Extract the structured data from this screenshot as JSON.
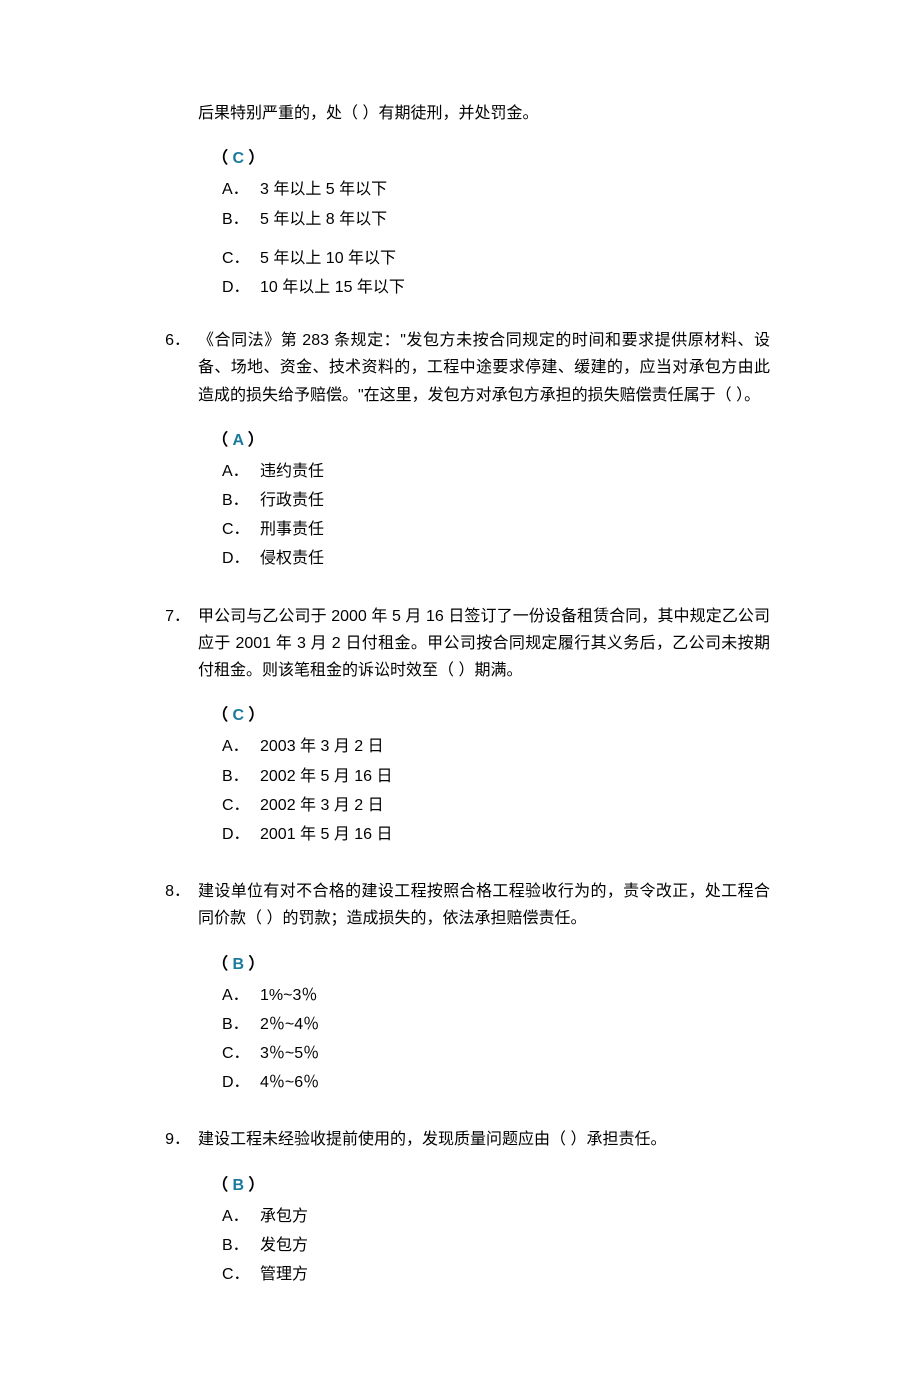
{
  "continuation": {
    "text": "后果特别严重的，处（ ）有期徒刑，并处罚金。",
    "answer": "C",
    "options": [
      {
        "letter": "A．",
        "text": "3 年以上 5 年以下"
      },
      {
        "letter": "B．",
        "text": "5 年以上 8 年以下"
      },
      {
        "letter": "C．",
        "text": "5 年以上 10 年以下"
      },
      {
        "letter": "D．",
        "text": "10 年以上 15 年以下"
      }
    ]
  },
  "questions": [
    {
      "num": "6．",
      "text": "《合同法》第 283 条规定：\"发包方未按合同规定的时间和要求提供原材料、设备、场地、资金、技术资料的，工程中途要求停建、缓建的，应当对承包方由此造成的损失给予赔偿。\"在这里，发包方对承包方承担的损失赔偿责任属于（ ）。",
      "answer": "A",
      "options": [
        {
          "letter": "A．",
          "text": "违约责任"
        },
        {
          "letter": "B．",
          "text": "行政责任"
        },
        {
          "letter": "C．",
          "text": "刑事责任"
        },
        {
          "letter": "D．",
          "text": "侵权责任"
        }
      ]
    },
    {
      "num": "7．",
      "text": "甲公司与乙公司于 2000 年 5 月 16 日签订了一份设备租赁合同，其中规定乙公司应于 2001 年 3 月 2 日付租金。甲公司按合同规定履行其义务后，乙公司未按期付租金。则该笔租金的诉讼时效至（ ）期满。",
      "answer": "C",
      "options": [
        {
          "letter": "A．",
          "text": "2003 年 3 月 2 日"
        },
        {
          "letter": "B．",
          "text": "2002 年 5 月 16 日"
        },
        {
          "letter": "C．",
          "text": "2002 年 3 月 2 日"
        },
        {
          "letter": "D．",
          "text": "2001 年 5 月 16 日"
        }
      ]
    },
    {
      "num": "8．",
      "text": "建设单位有对不合格的建设工程按照合格工程验收行为的，责令改正，处工程合同价款（ ）的罚款；造成损失的，依法承担赔偿责任。",
      "answer": "B",
      "options": [
        {
          "letter": "A．",
          "text": "1%~3％"
        },
        {
          "letter": "B．",
          "text": "2％~4％"
        },
        {
          "letter": "C．",
          "text": "3％~5％"
        },
        {
          "letter": "D．",
          "text": "4％~6％"
        }
      ]
    },
    {
      "num": "9．",
      "text": "建设工程未经验收提前使用的，发现质量问题应由（ ）承担责任。",
      "answer": "B",
      "options": [
        {
          "letter": "A．",
          "text": "承包方"
        },
        {
          "letter": "B．",
          "text": "发包方"
        },
        {
          "letter": "C．",
          "text": "管理方"
        }
      ]
    }
  ]
}
